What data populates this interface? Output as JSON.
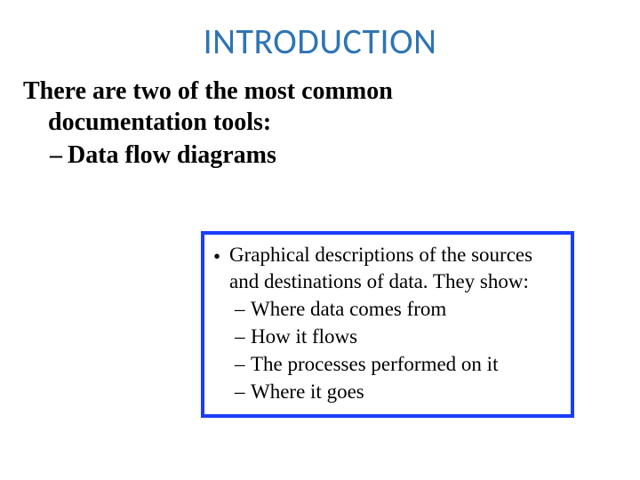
{
  "title": "INTRODUCTION",
  "intro_line1": "There are two of the most common",
  "intro_line2": "documentation tools:",
  "sub_dash_label": "Data flow diagrams",
  "callout": {
    "bullet_text": "Graphical descriptions of the sources and destinations of data. They show:",
    "sub": [
      "Where data comes from",
      "How it flows",
      "The processes performed on it",
      "Where it goes"
    ]
  }
}
